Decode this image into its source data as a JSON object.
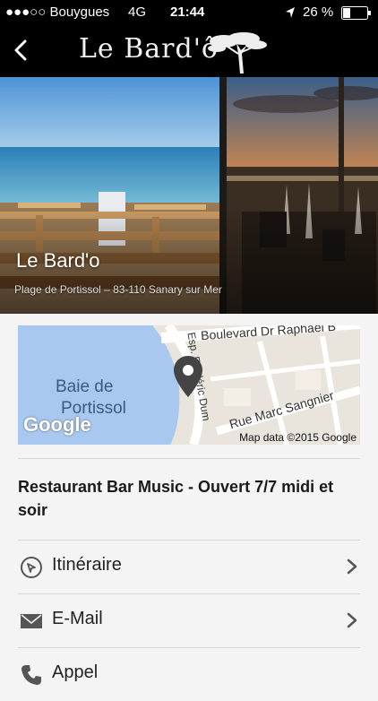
{
  "status": {
    "carrier": "●●●○○ Bouygues",
    "network": "4G",
    "time": "21:44",
    "battery": "26 %"
  },
  "nav": {
    "brand": "Le Bard'ô"
  },
  "hero": {
    "title": "Le Bard'o",
    "address": "Plage de Portissol – 83-110 Sanary sur Mer"
  },
  "map": {
    "water_label_1": "Baie de",
    "water_label_2": "Portissol",
    "road_1": "Boulevard Dr Raphaël B",
    "road_2": "Rue Marc Sangnier",
    "road_3": "Esp. Frédéric Dum",
    "logo": "Google",
    "attribution": "Map data ©2015 Google"
  },
  "description": "Restaurant Bar Music - Ouvert 7/7 midi et soir",
  "actions": [
    {
      "label": "Itinéraire",
      "icon": "compass-icon"
    },
    {
      "label": "E-Mail",
      "icon": "envelope-icon"
    },
    {
      "label": "Appel",
      "icon": "phone-icon"
    }
  ],
  "colors": {
    "bar": "#000000",
    "background": "#f4f4f4",
    "water": "#a8c8f0",
    "pin": "#444444"
  }
}
